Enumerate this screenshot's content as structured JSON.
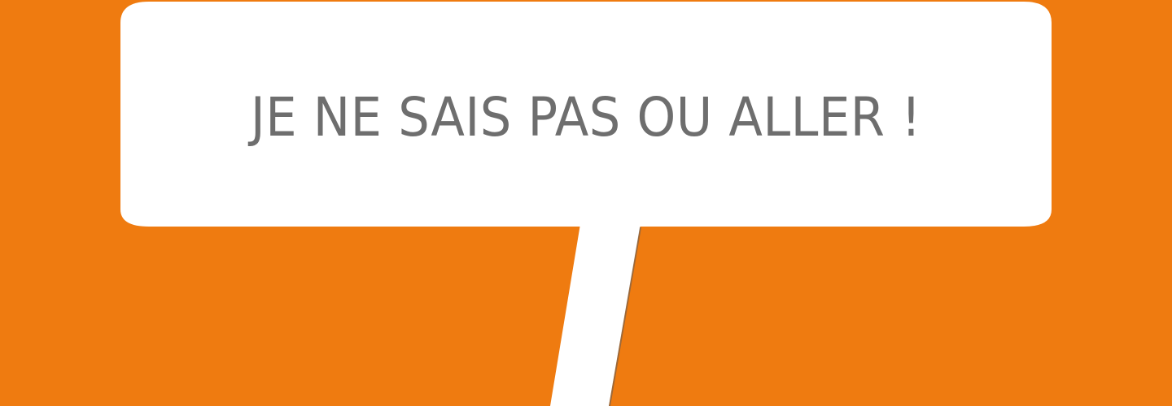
{
  "sign": {
    "message": "JE NE SAIS PAS OU ALLER !"
  },
  "colors": {
    "background": "#EF7B10",
    "sign_fill": "#FFFFFF",
    "text": "#6E6E6E",
    "pole_shadow": "#5A5A5A"
  }
}
